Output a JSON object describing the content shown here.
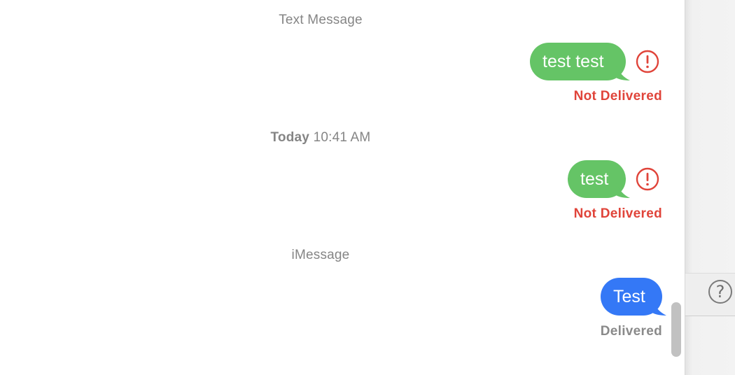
{
  "conversation": {
    "messages": [
      {
        "service_header": "Text Message",
        "text": "test test",
        "status": "Not Delivered",
        "error_icon": "exclamation-circle-icon",
        "bubble_color": "#65c466"
      },
      {
        "timestamp_day": "Today",
        "timestamp_time": "10:41 AM",
        "text": "test",
        "status": "Not Delivered",
        "error_icon": "exclamation-circle-icon",
        "bubble_color": "#65c466"
      },
      {
        "service_header": "iMessage",
        "text": "Test",
        "status": "Delivered",
        "bubble_color": "#3478f6"
      }
    ]
  },
  "side_panel": {
    "help_icon": "question-mark-circle-icon",
    "help_label": "?"
  },
  "colors": {
    "error_red": "#e0443a",
    "sms_green": "#65c466",
    "imessage_blue": "#3478f6",
    "meta_gray": "#858585"
  }
}
